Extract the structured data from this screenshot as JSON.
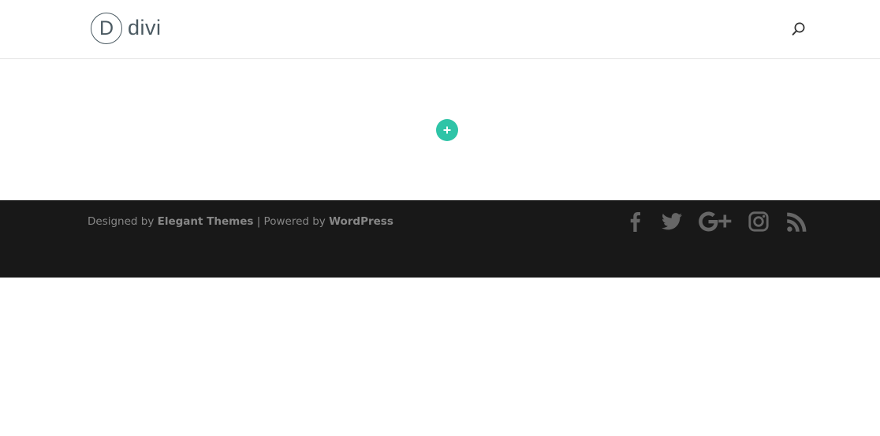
{
  "header": {
    "logo_mark": "D",
    "logo_text": "divi",
    "search_icon": "search-icon"
  },
  "main": {
    "add_icon": "plus-icon",
    "accent_color": "#2ec4a7"
  },
  "footer": {
    "credits": {
      "designed_by": "Designed by ",
      "elegant_themes": "Elegant Themes",
      "separator": " | Powered by ",
      "wordpress": "WordPress"
    },
    "social": [
      {
        "name": "facebook-icon"
      },
      {
        "name": "twitter-icon"
      },
      {
        "name": "google-plus-icon"
      },
      {
        "name": "instagram-icon"
      },
      {
        "name": "rss-icon"
      }
    ],
    "background_color": "#181818"
  }
}
